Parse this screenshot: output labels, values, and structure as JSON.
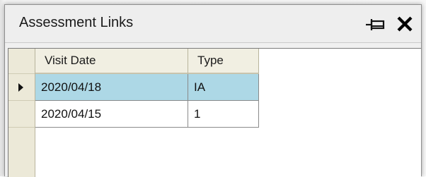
{
  "window": {
    "title": "Assessment Links",
    "pin_icon": "pin-icon",
    "close_icon": "close-icon"
  },
  "grid": {
    "columns": [
      "Visit Date",
      "Type"
    ],
    "rows": [
      {
        "visit_date": "2020/04/18",
        "type": "IA",
        "selected": true
      },
      {
        "visit_date": "2020/04/15",
        "type": "1",
        "selected": false
      }
    ]
  },
  "colors": {
    "selected_row": "#add8e6",
    "row_header_bg": "#ece9d8",
    "titlebar_bg": "#eeeeee"
  }
}
